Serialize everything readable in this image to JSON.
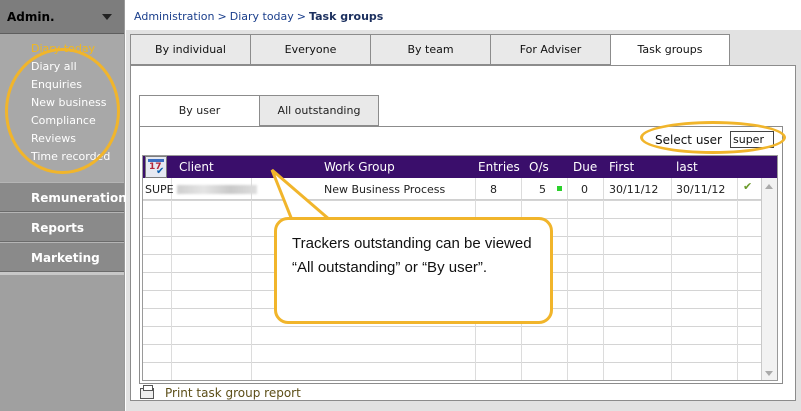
{
  "sidebar": {
    "admin_label": "Admin.",
    "admin_items": [
      {
        "label": "Diary today",
        "active": true
      },
      {
        "label": "Diary all",
        "active": false
      },
      {
        "label": "Enquiries",
        "active": false
      },
      {
        "label": "New business",
        "active": false
      },
      {
        "label": "Compliance",
        "active": false
      },
      {
        "label": "Reviews",
        "active": false
      },
      {
        "label": "Time recorded",
        "active": false
      }
    ],
    "sections": [
      "Remuneration",
      "Reports",
      "Marketing"
    ]
  },
  "breadcrumb": {
    "items": [
      "Administration",
      "Diary today"
    ],
    "separator": ">",
    "current": "Task groups"
  },
  "top_tabs": [
    "By individual",
    "Everyone",
    "By team",
    "For Adviser",
    "Task groups"
  ],
  "top_tab_active": "Task groups",
  "sub_tabs": [
    "By user",
    "All outstanding"
  ],
  "sub_tab_active": "By user",
  "select_user": {
    "label": "Select user",
    "value": "super"
  },
  "table": {
    "columns": [
      "Client",
      "Work Group",
      "Entries",
      "O/s",
      "Due",
      "First",
      "last"
    ],
    "rows": [
      {
        "user": "SUPE",
        "client": "",
        "work_group": "New Business Process",
        "entries": "8",
        "os": "5",
        "due": "0",
        "first": "30/11/12",
        "last": "30/11/12",
        "done": true
      }
    ]
  },
  "print_label": "Print task group report",
  "callout": {
    "text": "Trackers outstanding can be viewed “All outstanding” or “By user”."
  },
  "colors": {
    "accent": "#f1b52b",
    "header": "#3a0e6b",
    "status_green": "#2bd12b"
  },
  "icons": [
    "calendar-icon",
    "print-icon",
    "checkmark-icon",
    "scroll-up-icon",
    "scroll-down-icon"
  ]
}
